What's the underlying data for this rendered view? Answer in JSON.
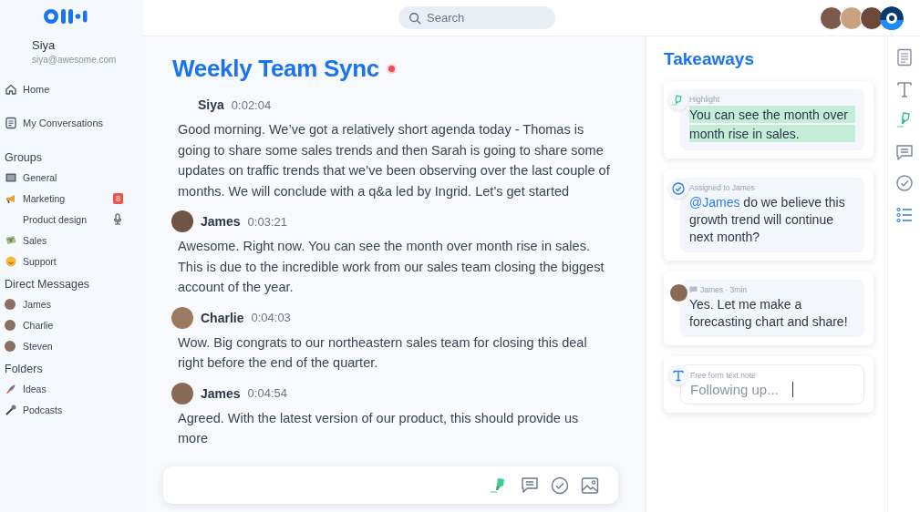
{
  "sidebar": {
    "user": {
      "name": "Siya",
      "email": "siya@awesome.com"
    },
    "nav": [
      {
        "label": "Home"
      },
      {
        "label": "My Conversations"
      }
    ],
    "sections": [
      {
        "title": "Groups",
        "items": [
          {
            "label": "General"
          },
          {
            "label": "Marketing",
            "badge": "8"
          },
          {
            "label": "Product design",
            "recording": true
          },
          {
            "label": "Sales"
          },
          {
            "label": "Support"
          }
        ]
      },
      {
        "title": "Direct Messages",
        "items": [
          {
            "label": "James"
          },
          {
            "label": "Charlie"
          },
          {
            "label": "Steven"
          }
        ]
      },
      {
        "title": "Folders",
        "items": [
          {
            "label": "Ideas"
          },
          {
            "label": "Podcasts"
          }
        ]
      }
    ]
  },
  "search": {
    "placeholder": "Search"
  },
  "conversation": {
    "title": "Weekly Team Sync",
    "recording": true,
    "messages": [
      {
        "speaker": "Siya",
        "time": "0:02:04",
        "avatar": false,
        "text": "Good morning. We’ve got a relatively short agenda today - Thomas is going to share some sales trends and then Sarah is going to share some updates on traffic trends that we’ve been observing over the last couple of months. We will conclude with a q&a led by Ingrid. Let’s get started"
      },
      {
        "speaker": "James",
        "time": "0:03:21",
        "avatar": true,
        "text": "Awesome. Right now. You can see the month over month rise in sales. This is due to the incredible work from our sales team closing the biggest account of the year."
      },
      {
        "speaker": "Charlie",
        "time": "0:04:03",
        "avatar": true,
        "text": "Wow. Big congrats to our northeastern sales team for closing this deal right before the end of the quarter."
      },
      {
        "speaker": "James",
        "time": "0:04:54",
        "avatar": true,
        "text": "Agreed. With the latest version of our product, this should provide us more"
      }
    ]
  },
  "takeaways": {
    "title": "Takeaways",
    "cards": [
      {
        "kind": "highlight",
        "label": "Highlight",
        "text": "You can see the month over month rise in sales."
      },
      {
        "kind": "assignment",
        "label": "Assigned to James",
        "mention": "@James",
        "text": "do we believe this growth trend will continue next month?"
      },
      {
        "kind": "comment",
        "label": "James · 3min",
        "text": "Yes. Let me make a forecasting chart and share!"
      },
      {
        "kind": "note",
        "label": "Free form text note",
        "value": "Following up..."
      }
    ]
  },
  "rail": [
    {
      "selected": false
    },
    {
      "selected": false
    },
    {
      "selected": false
    },
    {
      "selected": false
    },
    {
      "selected": false
    },
    {
      "selected": true
    }
  ]
}
